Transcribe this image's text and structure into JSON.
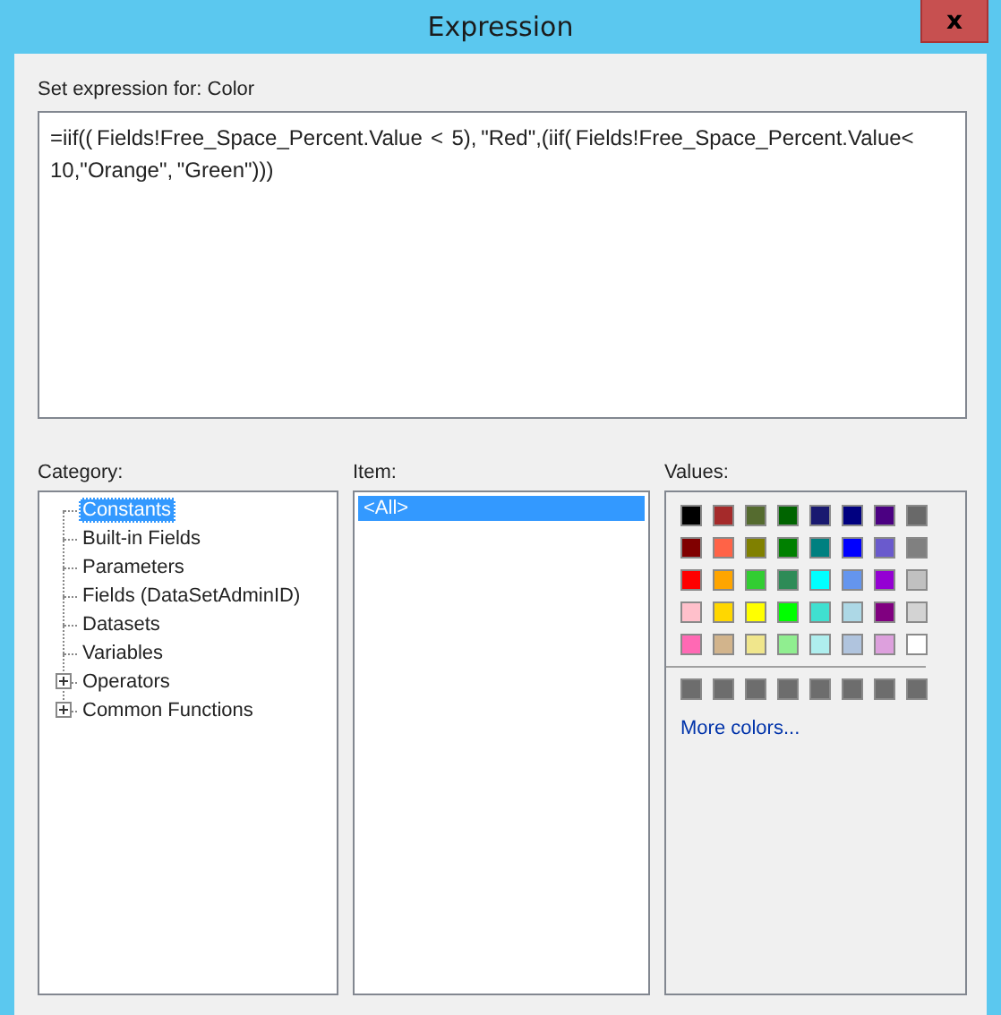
{
  "window": {
    "title": "Expression",
    "close_label": "x"
  },
  "expression": {
    "label": "Set expression for: Color",
    "value": "=iif(( Fields!Free_Space_Percent.Value  <  5), \"Red\",(iif( Fields!Free_Space_Percent.Value< 10,\"Orange\", \"Green\")))"
  },
  "category": {
    "label": "Category:",
    "items": [
      {
        "label": "Constants",
        "selected": true,
        "expandable": false
      },
      {
        "label": "Built-in Fields",
        "selected": false,
        "expandable": false
      },
      {
        "label": "Parameters",
        "selected": false,
        "expandable": false
      },
      {
        "label": "Fields (DataSetAdminID)",
        "selected": false,
        "expandable": false
      },
      {
        "label": "Datasets",
        "selected": false,
        "expandable": false
      },
      {
        "label": "Variables",
        "selected": false,
        "expandable": false
      },
      {
        "label": "Operators",
        "selected": false,
        "expandable": true
      },
      {
        "label": "Common Functions",
        "selected": false,
        "expandable": true
      }
    ]
  },
  "item": {
    "label": "Item:",
    "items": [
      {
        "label": "<All>",
        "selected": true
      }
    ]
  },
  "values": {
    "label": "Values:",
    "swatches": [
      {
        "color": "#000000"
      },
      {
        "color": "#a52a2a"
      },
      {
        "color": "#556b2f"
      },
      {
        "color": "#006400"
      },
      {
        "color": "#191970"
      },
      {
        "color": "#000080"
      },
      {
        "color": "#4b0082"
      },
      {
        "color": "#696969"
      },
      {
        "color": "#800000"
      },
      {
        "color": "#ff6347"
      },
      {
        "color": "#808000"
      },
      {
        "color": "#008000"
      },
      {
        "color": "#008080"
      },
      {
        "color": "#0000ff"
      },
      {
        "color": "#6a5acd"
      },
      {
        "color": "#808080"
      },
      {
        "color": "#ff0000"
      },
      {
        "color": "#ffa500"
      },
      {
        "color": "#32cd32"
      },
      {
        "color": "#2e8b57"
      },
      {
        "color": "#00ffff"
      },
      {
        "color": "#6495ed"
      },
      {
        "color": "#9400d3"
      },
      {
        "color": "#c0c0c0"
      },
      {
        "color": "#ffc0cb"
      },
      {
        "color": "#ffd700"
      },
      {
        "color": "#ffff00"
      },
      {
        "color": "#00ff00"
      },
      {
        "color": "#40e0d0"
      },
      {
        "color": "#add8e6"
      },
      {
        "color": "#800080"
      },
      {
        "color": "#d3d3d3"
      },
      {
        "color": "#ff69b4"
      },
      {
        "color": "#d2b48c"
      },
      {
        "color": "#f0e68c"
      },
      {
        "color": "#90ee90"
      },
      {
        "color": "#afeeee"
      },
      {
        "color": "#b0c4de"
      },
      {
        "color": "#dda0dd"
      },
      {
        "color": "#ffffff"
      }
    ],
    "custom_swatches": [
      {
        "color": "#6d6d6d"
      },
      {
        "color": "#6d6d6d"
      },
      {
        "color": "#6d6d6d"
      },
      {
        "color": "#6d6d6d"
      },
      {
        "color": "#6d6d6d"
      },
      {
        "color": "#6d6d6d"
      },
      {
        "color": "#6d6d6d"
      },
      {
        "color": "#6d6d6d"
      }
    ],
    "more_link": "More colors..."
  }
}
